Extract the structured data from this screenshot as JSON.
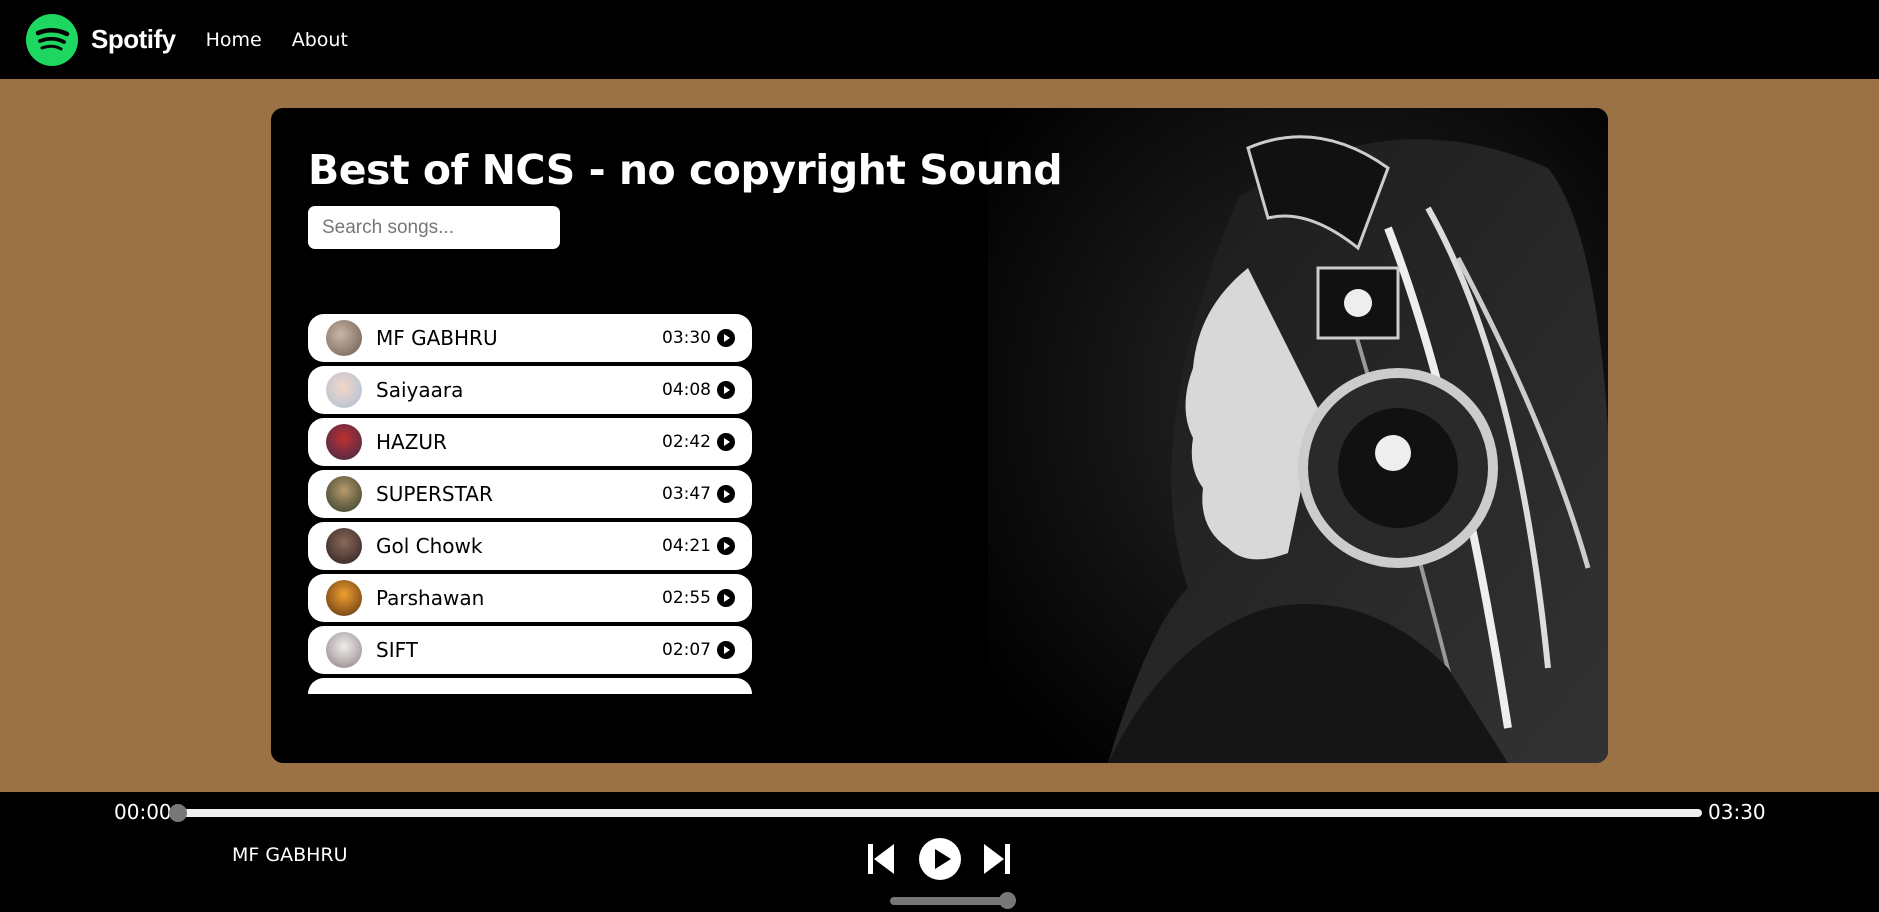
{
  "nav": {
    "brand": "Spotify",
    "links": [
      "Home",
      "About"
    ]
  },
  "main": {
    "title": "Best of NCS - no copyright Sound",
    "search_placeholder": "Search songs...",
    "songs": [
      {
        "name": "MF GABHRU",
        "duration": "03:30"
      },
      {
        "name": "Saiyaara",
        "duration": "04:08"
      },
      {
        "name": "HAZUR",
        "duration": "02:42"
      },
      {
        "name": "SUPERSTAR",
        "duration": "03:47"
      },
      {
        "name": "Gol Chowk",
        "duration": "04:21"
      },
      {
        "name": "Parshawan",
        "duration": "02:55"
      },
      {
        "name": "SIFT",
        "duration": "02:07"
      }
    ]
  },
  "player": {
    "current_time": "00:00",
    "total_time": "03:30",
    "now_playing": "MF GABHRU",
    "progress_fraction": 0.0,
    "volume_fraction": 1.0
  },
  "colors": {
    "background": "#9a7245",
    "spotify_green": "#1ed760",
    "panel": "#000000"
  }
}
